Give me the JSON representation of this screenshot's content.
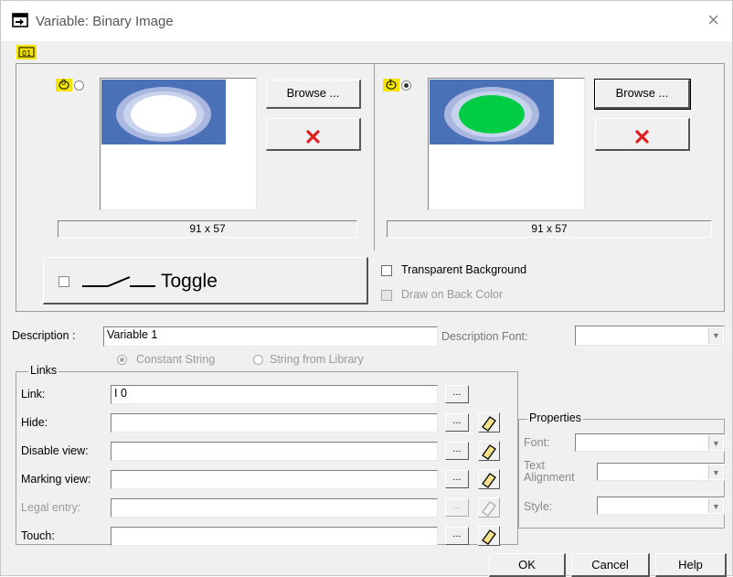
{
  "window": {
    "title": "Variable: Binary Image",
    "close_glyph": "×"
  },
  "states": [
    {
      "index_label": "0",
      "size_label": "91 x 57",
      "browse_label": "Browse ...",
      "fill_color": "#ffffff"
    },
    {
      "index_label": "1",
      "size_label": "91 x 57",
      "browse_label": "Browse ...",
      "fill_color": "#00cc44"
    }
  ],
  "toggle": {
    "label": "Toggle"
  },
  "options": {
    "transparent_background": "Transparent Background",
    "draw_on_back_color": "Draw on Back Color"
  },
  "description": {
    "label": "Description :",
    "value": "Variable 1",
    "font_label": "Description Font:",
    "constant_string": "Constant String",
    "string_from_library": "String from Library"
  },
  "links": {
    "title": "Links",
    "rows": [
      {
        "label": "Link:",
        "value": "I 0"
      },
      {
        "label": "Hide:",
        "value": ""
      },
      {
        "label": "Disable view:",
        "value": ""
      },
      {
        "label": "Marking view:",
        "value": ""
      },
      {
        "label": "Legal entry:",
        "value": ""
      },
      {
        "label": "Touch:",
        "value": ""
      }
    ],
    "dots_label": "..."
  },
  "properties": {
    "title": "Properties",
    "font_label": "Font:",
    "text_alignment_label_1": "Text",
    "text_alignment_label_2": "Alignment",
    "style_label": "Style:"
  },
  "footer": {
    "ok": "OK",
    "cancel": "Cancel",
    "help": "Help"
  },
  "icons": {
    "app": "binary-image-icon",
    "delete": "red-x-icon",
    "erase": "eraser-icon",
    "combo": "chevron-down-icon"
  },
  "colors": {
    "delete_red": "#e02020",
    "image_blue": "#4a70b8",
    "ring_light": "#aab8e0",
    "eraser_yellow": "#f3e08a"
  }
}
